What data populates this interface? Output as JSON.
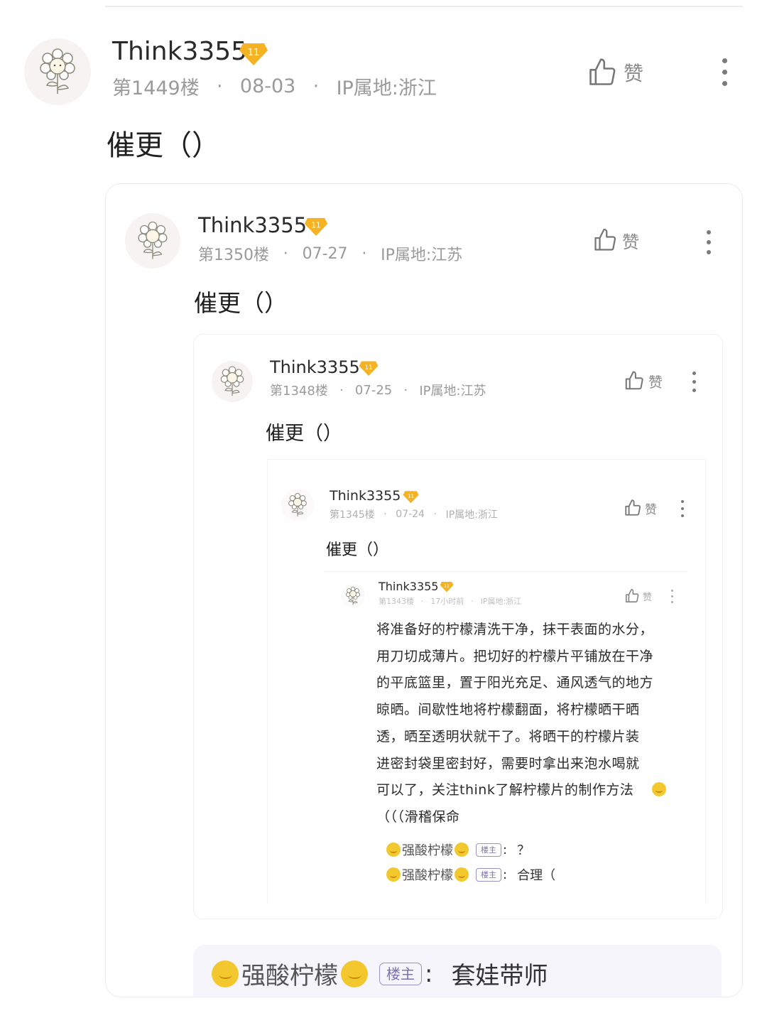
{
  "username": "Think3355",
  "badge_level": "11",
  "like_label": "赞",
  "posts": [
    {
      "floor": "第1449楼",
      "date": "08-03",
      "ip": "IP属地:浙江",
      "text": "催更（）"
    },
    {
      "floor": "第1350楼",
      "date": "07-27",
      "ip": "IP属地:江苏",
      "text": "催更（）"
    },
    {
      "floor": "第1348楼",
      "date": "07-25",
      "ip": "IP属地:江苏",
      "text": "催更（）"
    },
    {
      "floor": "第1345楼",
      "date": "07-24",
      "ip": "IP属地:浙江",
      "text": "催更（）"
    },
    {
      "floor": "第1343楼",
      "date": "17小时前",
      "ip": "IP属地:浙江",
      "lines": [
        "将准备好的柠檬清洗干净，抹干表面的水分，",
        "用刀切成薄片。把切好的柠檬片平铺放在干净",
        "的平底篮里，置于阳光充足、通风透气的地方",
        "晾晒。间歇性地将柠檬翻面，将柠檬晒干晒",
        "透，晒至透明状就干了。将晒干的柠檬片装",
        "进密封袋里密封好，需要时拿出来泡水喝就",
        "可以了，关注think了解柠檬片的制作方法",
        "（（（滑稽保命"
      ],
      "replies": [
        {
          "name": "强酸柠檬",
          "tag": "楼主",
          "sep": ":",
          "text": "？"
        },
        {
          "name": "强酸柠檬",
          "tag": "楼主",
          "sep": ":",
          "text": "合理（"
        }
      ]
    }
  ],
  "bottom_reply": {
    "name": "强酸柠檬",
    "tag": "楼主",
    "sep": ":",
    "text": "套娃带师"
  },
  "colors": {
    "badge": "#f5b324",
    "tag_border": "#9a93c4",
    "emoji": "#f3c82e"
  }
}
